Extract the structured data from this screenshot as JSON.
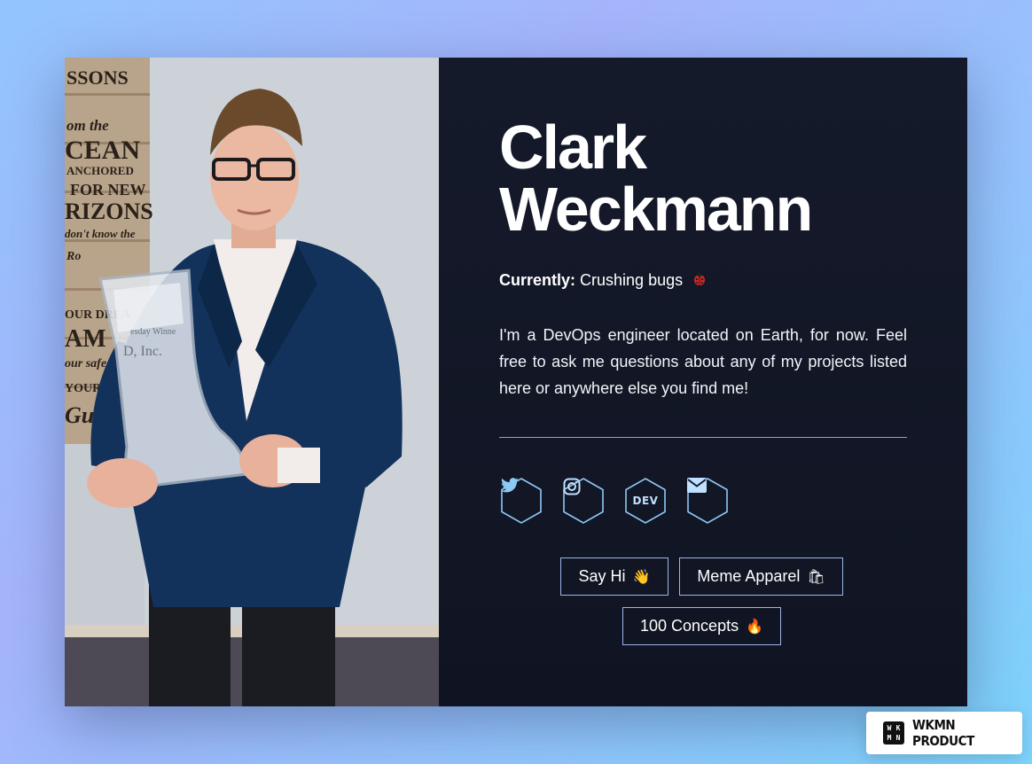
{
  "profile": {
    "first_name": "Clark",
    "last_name": "Weckmann",
    "status_label": "Currently:",
    "status_text": "Crushing bugs",
    "status_icon": "ladybug-icon",
    "bio": "I'm a DevOps engineer located on Earth, for now. Feel free to ask me questions about any of my projects listed here or anywhere else you find me!"
  },
  "photo": {
    "sign_lines": [
      "SSONS",
      "om the",
      "CEAN",
      "ANCHORED",
      "FOR NEW",
      "RIZONS",
      "don't know the",
      "Ro",
      "OUR DREA",
      "AM",
      "our safe",
      "YOUR HEART",
      "Guid"
    ],
    "trophy_text": [
      "esday Winne",
      "D, Inc."
    ]
  },
  "socials": [
    {
      "name": "twitter-icon"
    },
    {
      "name": "instagram-icon"
    },
    {
      "name": "dev-icon",
      "text": "DEV"
    },
    {
      "name": "email-icon"
    }
  ],
  "buttons": {
    "say_hi": {
      "label": "Say Hi",
      "emoji": "👋"
    },
    "meme_apparel": {
      "label": "Meme Apparel",
      "emoji": "🛍"
    },
    "concepts": {
      "label": "100 Concepts",
      "emoji": "🔥"
    }
  },
  "badge": {
    "label": "WKMN PRODUCT",
    "logo_letters": [
      "W",
      "K",
      "M",
      "N"
    ]
  },
  "colors": {
    "panel_bg": "#151a2b",
    "accent": "#9db5e8",
    "icon": "#8ec8f5"
  }
}
